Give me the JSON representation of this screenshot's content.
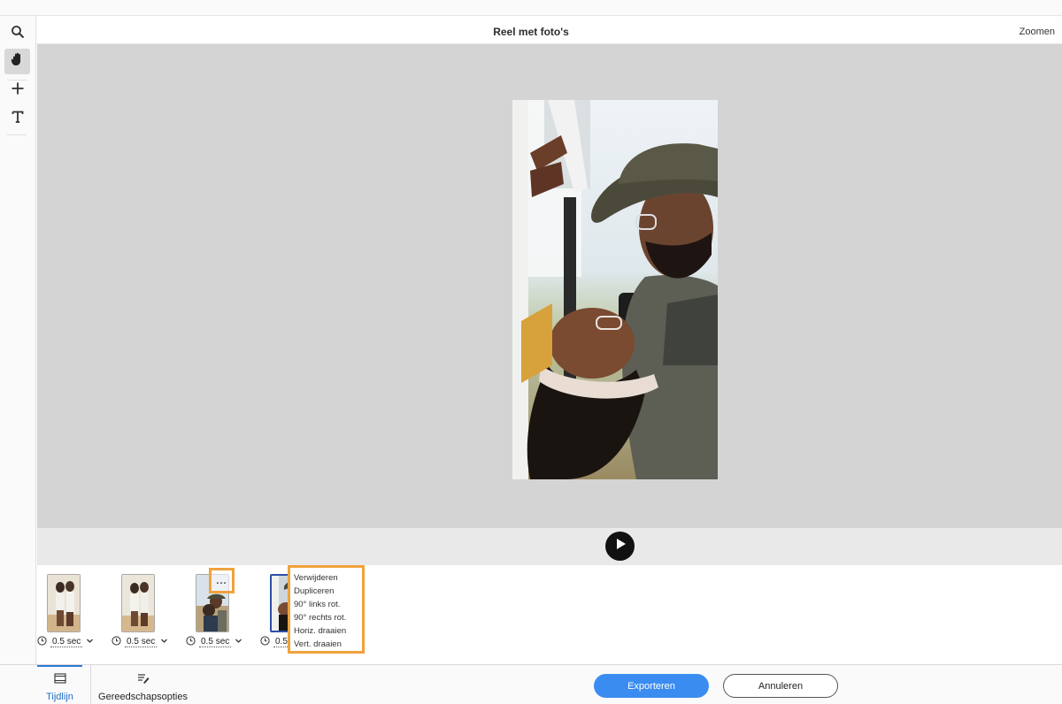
{
  "title": "Reel met foto's",
  "zoom_label": "Zoomen",
  "tools": [
    {
      "name": "zoom-tool",
      "icon": "magnifier-icon"
    },
    {
      "name": "hand-tool",
      "icon": "hand-icon",
      "active": true
    },
    {
      "name": "move-tool",
      "icon": "move-cross-icon"
    },
    {
      "name": "text-tool",
      "icon": "text-t-icon"
    }
  ],
  "timeline": {
    "clips": [
      {
        "duration": "0.5",
        "unit": "sec"
      },
      {
        "duration": "0.5",
        "unit": "sec"
      },
      {
        "duration": "0.5",
        "unit": "sec"
      },
      {
        "duration": "0.5",
        "unit": "sec"
      }
    ],
    "more_button": "..."
  },
  "context_menu": [
    "Verwijderen",
    "Dupliceren",
    "90° links rot.",
    "90° rechts rot.",
    "Horiz. draaien",
    "Vert. draaien"
  ],
  "bottom_tabs": {
    "timeline": "Tijdlijn",
    "tool_options": "Gereedschapsopties"
  },
  "buttons": {
    "export": "Exporteren",
    "cancel": "Annuleren"
  },
  "colors": {
    "accent": "#3a8cf0",
    "highlight": "#f0a23c",
    "canvas": "#d4d4d4"
  }
}
